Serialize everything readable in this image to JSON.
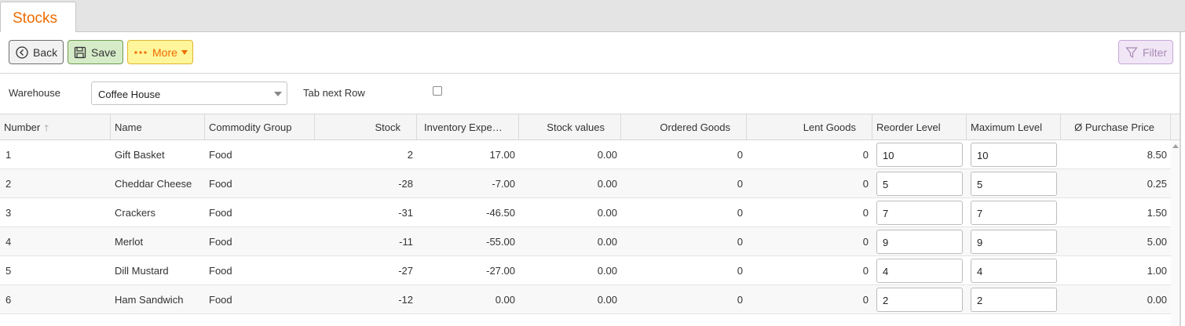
{
  "tab": {
    "title": "Stocks"
  },
  "toolbar": {
    "back_label": "Back",
    "save_label": "Save",
    "more_label": "More",
    "filter_label": "Filter"
  },
  "filters": {
    "warehouse_label": "Warehouse",
    "warehouse_value": "Coffee House",
    "tab_next_row_label": "Tab next Row"
  },
  "table": {
    "columns": [
      "Number",
      "Name",
      "Commodity Group",
      "Stock",
      "Inventory Expe…",
      "Stock values",
      "Ordered Goods",
      "Lent Goods",
      "Reorder Level",
      "Maximum Level",
      "Ø Purchase Price"
    ],
    "rows": [
      {
        "number": "1",
        "name": "Gift Basket",
        "group": "Food",
        "stock": "2",
        "inventory": "17.00",
        "stock_values": "0.00",
        "ordered": "0",
        "lent": "0",
        "reorder": "10",
        "maximum": "10",
        "purchase_price": "8.50"
      },
      {
        "number": "2",
        "name": "Cheddar Cheese",
        "group": "Food",
        "stock": "-28",
        "inventory": "-7.00",
        "stock_values": "0.00",
        "ordered": "0",
        "lent": "0",
        "reorder": "5",
        "maximum": "5",
        "purchase_price": "0.25"
      },
      {
        "number": "3",
        "name": "Crackers",
        "group": "Food",
        "stock": "-31",
        "inventory": "-46.50",
        "stock_values": "0.00",
        "ordered": "0",
        "lent": "0",
        "reorder": "7",
        "maximum": "7",
        "purchase_price": "1.50"
      },
      {
        "number": "4",
        "name": "Merlot",
        "group": "Food",
        "stock": "-11",
        "inventory": "-55.00",
        "stock_values": "0.00",
        "ordered": "0",
        "lent": "0",
        "reorder": "9",
        "maximum": "9",
        "purchase_price": "5.00"
      },
      {
        "number": "5",
        "name": "Dill Mustard",
        "group": "Food",
        "stock": "-27",
        "inventory": "-27.00",
        "stock_values": "0.00",
        "ordered": "0",
        "lent": "0",
        "reorder": "4",
        "maximum": "4",
        "purchase_price": "1.00"
      },
      {
        "number": "6",
        "name": "Ham Sandwich",
        "group": "Food",
        "stock": "-12",
        "inventory": "0.00",
        "stock_values": "0.00",
        "ordered": "0",
        "lent": "0",
        "reorder": "2",
        "maximum": "2",
        "purchase_price": "0.00"
      }
    ]
  },
  "colors": {
    "tab_title": "#ef6c00",
    "save_bg": "#d6ecc8",
    "more_bg": "#fff59a",
    "filter_bg": "#f1e6f6"
  },
  "icons": [
    "back-circle-icon",
    "save-disk-icon",
    "more-dots-icon",
    "caret-down-icon",
    "filter-funnel-icon",
    "sort-up-icon"
  ]
}
